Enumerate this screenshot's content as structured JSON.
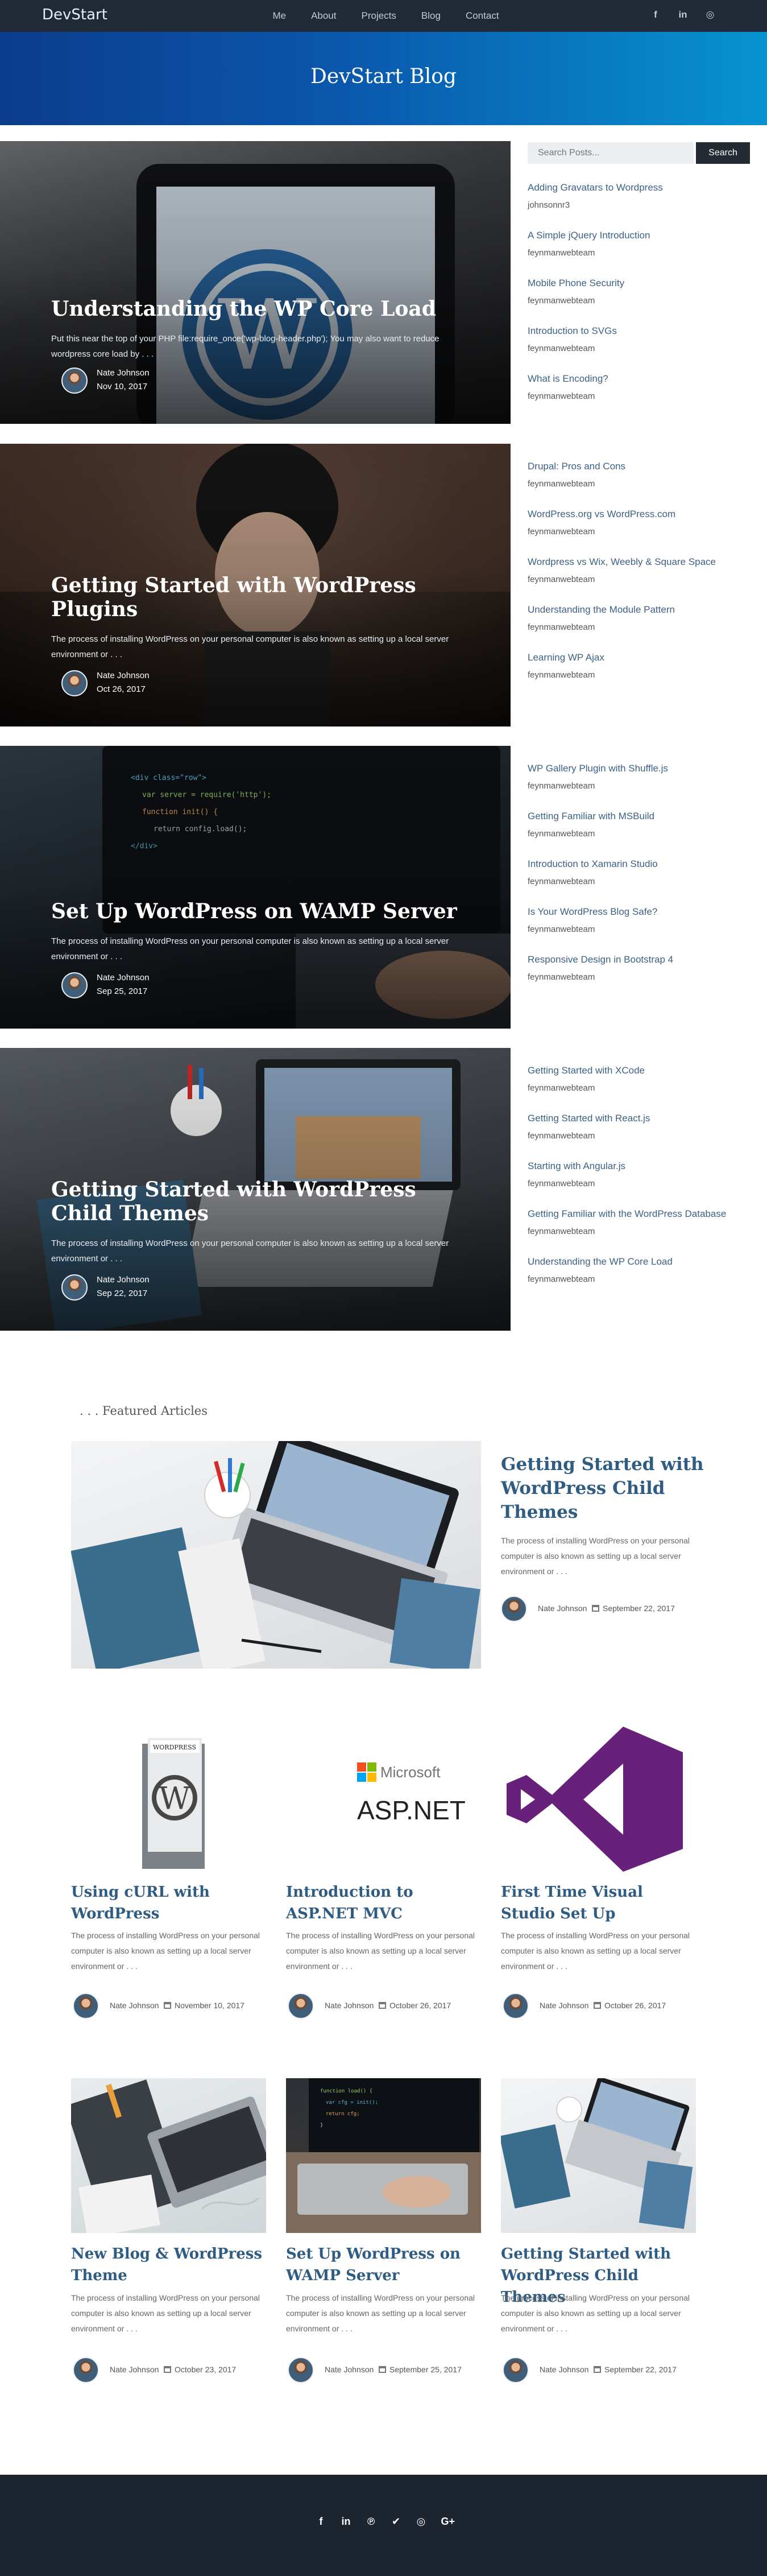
{
  "nav": {
    "brand": "DevStart",
    "links": [
      "Me",
      "About",
      "Projects",
      "Blog",
      "Contact"
    ],
    "social": [
      {
        "name": "facebook-icon",
        "glyph": "f"
      },
      {
        "name": "linkedin-icon",
        "glyph": "in"
      },
      {
        "name": "instagram-icon",
        "glyph": "◎"
      }
    ]
  },
  "hero": {
    "title": "DevStart Blog"
  },
  "posts": [
    {
      "title": "Understanding the WP Core Load",
      "excerpt": "Put this near the top of your PHP file:require_once('wp-blog-header.php'); You may also want to reduce wordpress core load by . . .",
      "author": "Nate Johnson",
      "date": "Nov 10, 2017"
    },
    {
      "title": "Getting Started with WordPress Plugins",
      "excerpt": "The process of installing WordPress on your personal computer is also known as setting up a local server environment or . . .",
      "author": "Nate Johnson",
      "date": "Oct 26, 2017"
    },
    {
      "title": "Set Up WordPress on WAMP Server",
      "excerpt": "The process of installing WordPress on your personal computer is also known as setting up a local server environment or . . .",
      "author": "Nate Johnson",
      "date": "Sep 25, 2017"
    },
    {
      "title": "Getting Started with WordPress Child Themes",
      "excerpt": "The process of installing WordPress on your personal computer is also known as setting up a local server environment or . . .",
      "author": "Nate Johnson",
      "date": "Sep 22, 2017"
    }
  ],
  "sidebar": {
    "search_placeholder": "Search Posts...",
    "search_button": "Search",
    "items": [
      {
        "title": "Adding Gravatars to Wordpress",
        "author": "johnsonnr3"
      },
      {
        "title": "A Simple jQuery Introduction",
        "author": "feynmanwebteam"
      },
      {
        "title": "Mobile Phone Security",
        "author": "feynmanwebteam"
      },
      {
        "title": "Introduction to SVGs",
        "author": "feynmanwebteam"
      },
      {
        "title": "What is Encoding?",
        "author": "feynmanwebteam"
      },
      {
        "title": "Drupal: Pros and Cons",
        "author": "feynmanwebteam"
      },
      {
        "title": "WordPress.org vs WordPress.com",
        "author": "feynmanwebteam"
      },
      {
        "title": "Wordpress vs Wix, Weebly & Square Space",
        "author": "feynmanwebteam"
      },
      {
        "title": "Understanding the Module Pattern",
        "author": "feynmanwebteam"
      },
      {
        "title": "Learning WP Ajax",
        "author": "feynmanwebteam"
      },
      {
        "title": "WP Gallery Plugin with Shuffle.js",
        "author": "feynmanwebteam"
      },
      {
        "title": "Getting Familiar with MSBuild",
        "author": "feynmanwebteam"
      },
      {
        "title": "Introduction to Xamarin Studio",
        "author": "feynmanwebteam"
      },
      {
        "title": "Is Your WordPress Blog Safe?",
        "author": "feynmanwebteam"
      },
      {
        "title": "Responsive Design in Bootstrap 4",
        "author": "feynmanwebteam"
      },
      {
        "title": "Getting Started with XCode",
        "author": "feynmanwebteam"
      },
      {
        "title": "Getting Started with React.js",
        "author": "feynmanwebteam"
      },
      {
        "title": "Starting with Angular.js",
        "author": "feynmanwebteam"
      },
      {
        "title": "Getting Familiar with the WordPress Database",
        "author": "feynmanwebteam"
      },
      {
        "title": "Understanding the WP Core Load",
        "author": "feynmanwebteam"
      }
    ]
  },
  "featured": {
    "label": ". . . Featured Articles",
    "title": "Getting Started with WordPress Child Themes",
    "excerpt": "The process of installing WordPress on your personal computer is also known as setting up a local server environment or . . .",
    "author": "Nate Johnson",
    "date": "September 22, 2017"
  },
  "cards": [
    {
      "title": "Using cURL with WordPress",
      "excerpt": "The process of installing WordPress on your personal computer is also known as setting up a local server environment or . . .",
      "author": "Nate Johnson",
      "date": "November 10, 2017",
      "logo_brand": "WORDPRESS"
    },
    {
      "title": "Introduction to ASP.NET MVC",
      "excerpt": "The process of installing WordPress on your personal computer is also known as setting up a local server environment or . . .",
      "author": "Nate Johnson",
      "date": "October 26, 2017",
      "logo_brand": "Microsoft",
      "logo_product": "ASP.NET"
    },
    {
      "title": "First Time Visual Studio Set Up",
      "excerpt": "The process of installing WordPress on your personal computer is also known as setting up a local server environment or . . .",
      "author": "Nate Johnson",
      "date": "October 26, 2017"
    },
    {
      "title": "New Blog & WordPress Theme",
      "excerpt": "The process of installing WordPress on your personal computer is also known as setting up a local server environment or . . .",
      "author": "Nate Johnson",
      "date": "October 23, 2017"
    },
    {
      "title": "Set Up WordPress on WAMP Server",
      "excerpt": "The process of installing WordPress on your personal computer is also known as setting up a local server environment or . . .",
      "author": "Nate Johnson",
      "date": "September 25, 2017"
    },
    {
      "title": "Getting Started with WordPress Child Themes",
      "excerpt": "The process of installing WordPress on your personal computer is also known as setting up a local server environment or . . .",
      "author": "Nate Johnson",
      "date": "September 22, 2017"
    }
  ],
  "footer": {
    "social": [
      {
        "name": "facebook-icon",
        "glyph": "f"
      },
      {
        "name": "linkedin-icon",
        "glyph": "in"
      },
      {
        "name": "pinterest-icon",
        "glyph": "℗"
      },
      {
        "name": "twitter-icon",
        "glyph": "✔"
      },
      {
        "name": "instagram-icon",
        "glyph": "◎"
      },
      {
        "name": "google-plus-icon",
        "glyph": "G+"
      }
    ]
  },
  "colors": {
    "nav_bg": "#1f2a36",
    "hero_start": "#0c3c8c",
    "hero_end": "#0693cf",
    "link": "#3d6185",
    "heading": "#2f5c82",
    "footer_bg": "#1d2630"
  }
}
